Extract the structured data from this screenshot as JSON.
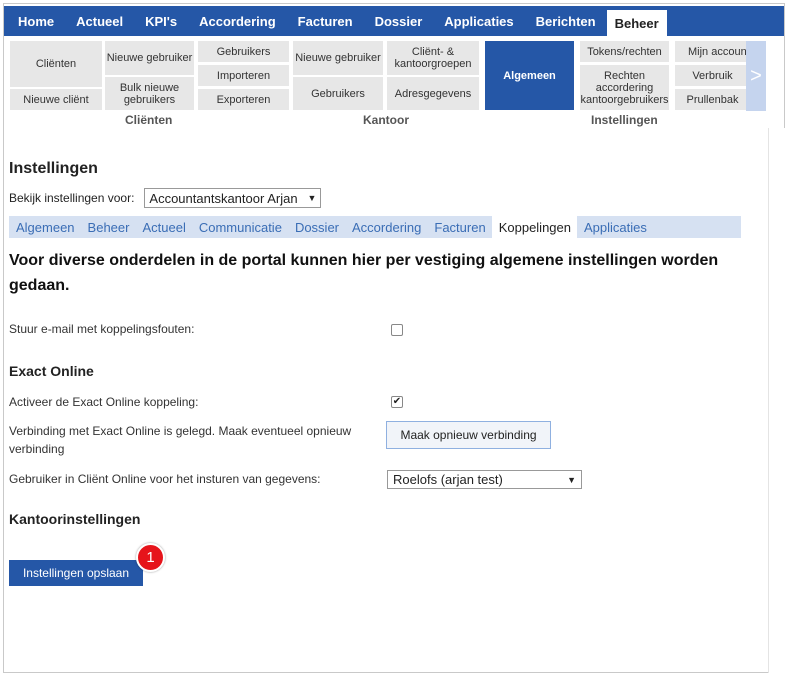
{
  "topnav": {
    "items": [
      "Home",
      "Actueel",
      "KPI's",
      "Accordering",
      "Facturen",
      "Dossier",
      "Applicaties",
      "Berichten",
      "Beheer"
    ],
    "active_index": 8
  },
  "ribbon": {
    "clienten_large": "Cliënten",
    "nieuwe_client": "Nieuwe cliënt",
    "nieuwe_gebruiker": "Nieuwe gebruiker",
    "bulk_nieuwe": "Bulk nieuwe gebruikers",
    "gebruikers": "Gebruikers",
    "importeren": "Importeren",
    "exporteren": "Exporteren",
    "k_nieuwe_gebruiker": "Nieuwe gebruiker",
    "k_gebruikers": "Gebruikers",
    "client_kantoorgroepen": "Cliënt- & kantoorgroepen",
    "adresgegevens": "Adresgegevens",
    "algemeen": "Algemeen",
    "tokens": "Tokens/rechten",
    "rechten": "Rechten accordering kantoorgebruikers",
    "mijn_account": "Mijn account",
    "verbruik": "Verbruik",
    "prullenbak": "Prullenbak",
    "group_clienten": "Cliënten",
    "group_kantoor": "Kantoor",
    "group_instellingen": "Instellingen",
    "scroll_arrow": ">"
  },
  "page": {
    "title": "Instellingen",
    "view_for_label": "Bekijk instellingen voor:",
    "view_for_value": "Accountantskantoor Arjan",
    "select_arrow": "▼"
  },
  "subtabs": {
    "items": [
      "Algemeen",
      "Beheer",
      "Actueel",
      "Communicatie",
      "Dossier",
      "Accordering",
      "Facturen",
      "Koppelingen",
      "Applicaties"
    ],
    "active_index": 7
  },
  "intro": "Voor diverse onderdelen in de portal kunnen hier per vestiging algemene instellingen worden gedaan.",
  "settings": {
    "email_errors_label": "Stuur e-mail met koppelingsfouten:",
    "email_errors_checked": false,
    "exact_heading": "Exact Online",
    "activate_label": "Activeer de Exact Online koppeling:",
    "activate_checked": true,
    "connection_label": "Verbinding met Exact Online is gelegd. Maak eventueel opnieuw verbinding",
    "reconnect_button": "Maak opnieuw verbinding",
    "user_label": "Gebruiker in Cliënt Online voor het insturen van gegevens:",
    "user_value": "Roelofs (arjan test)",
    "kantoor_heading": "Kantoorinstellingen",
    "save_button": "Instellingen opslaan",
    "badge": "1",
    "check_glyph": "✔"
  },
  "colors": {
    "nav_blue": "#2557a7",
    "subtab_bg": "#d6e1f2",
    "badge_red": "#e6141b"
  }
}
